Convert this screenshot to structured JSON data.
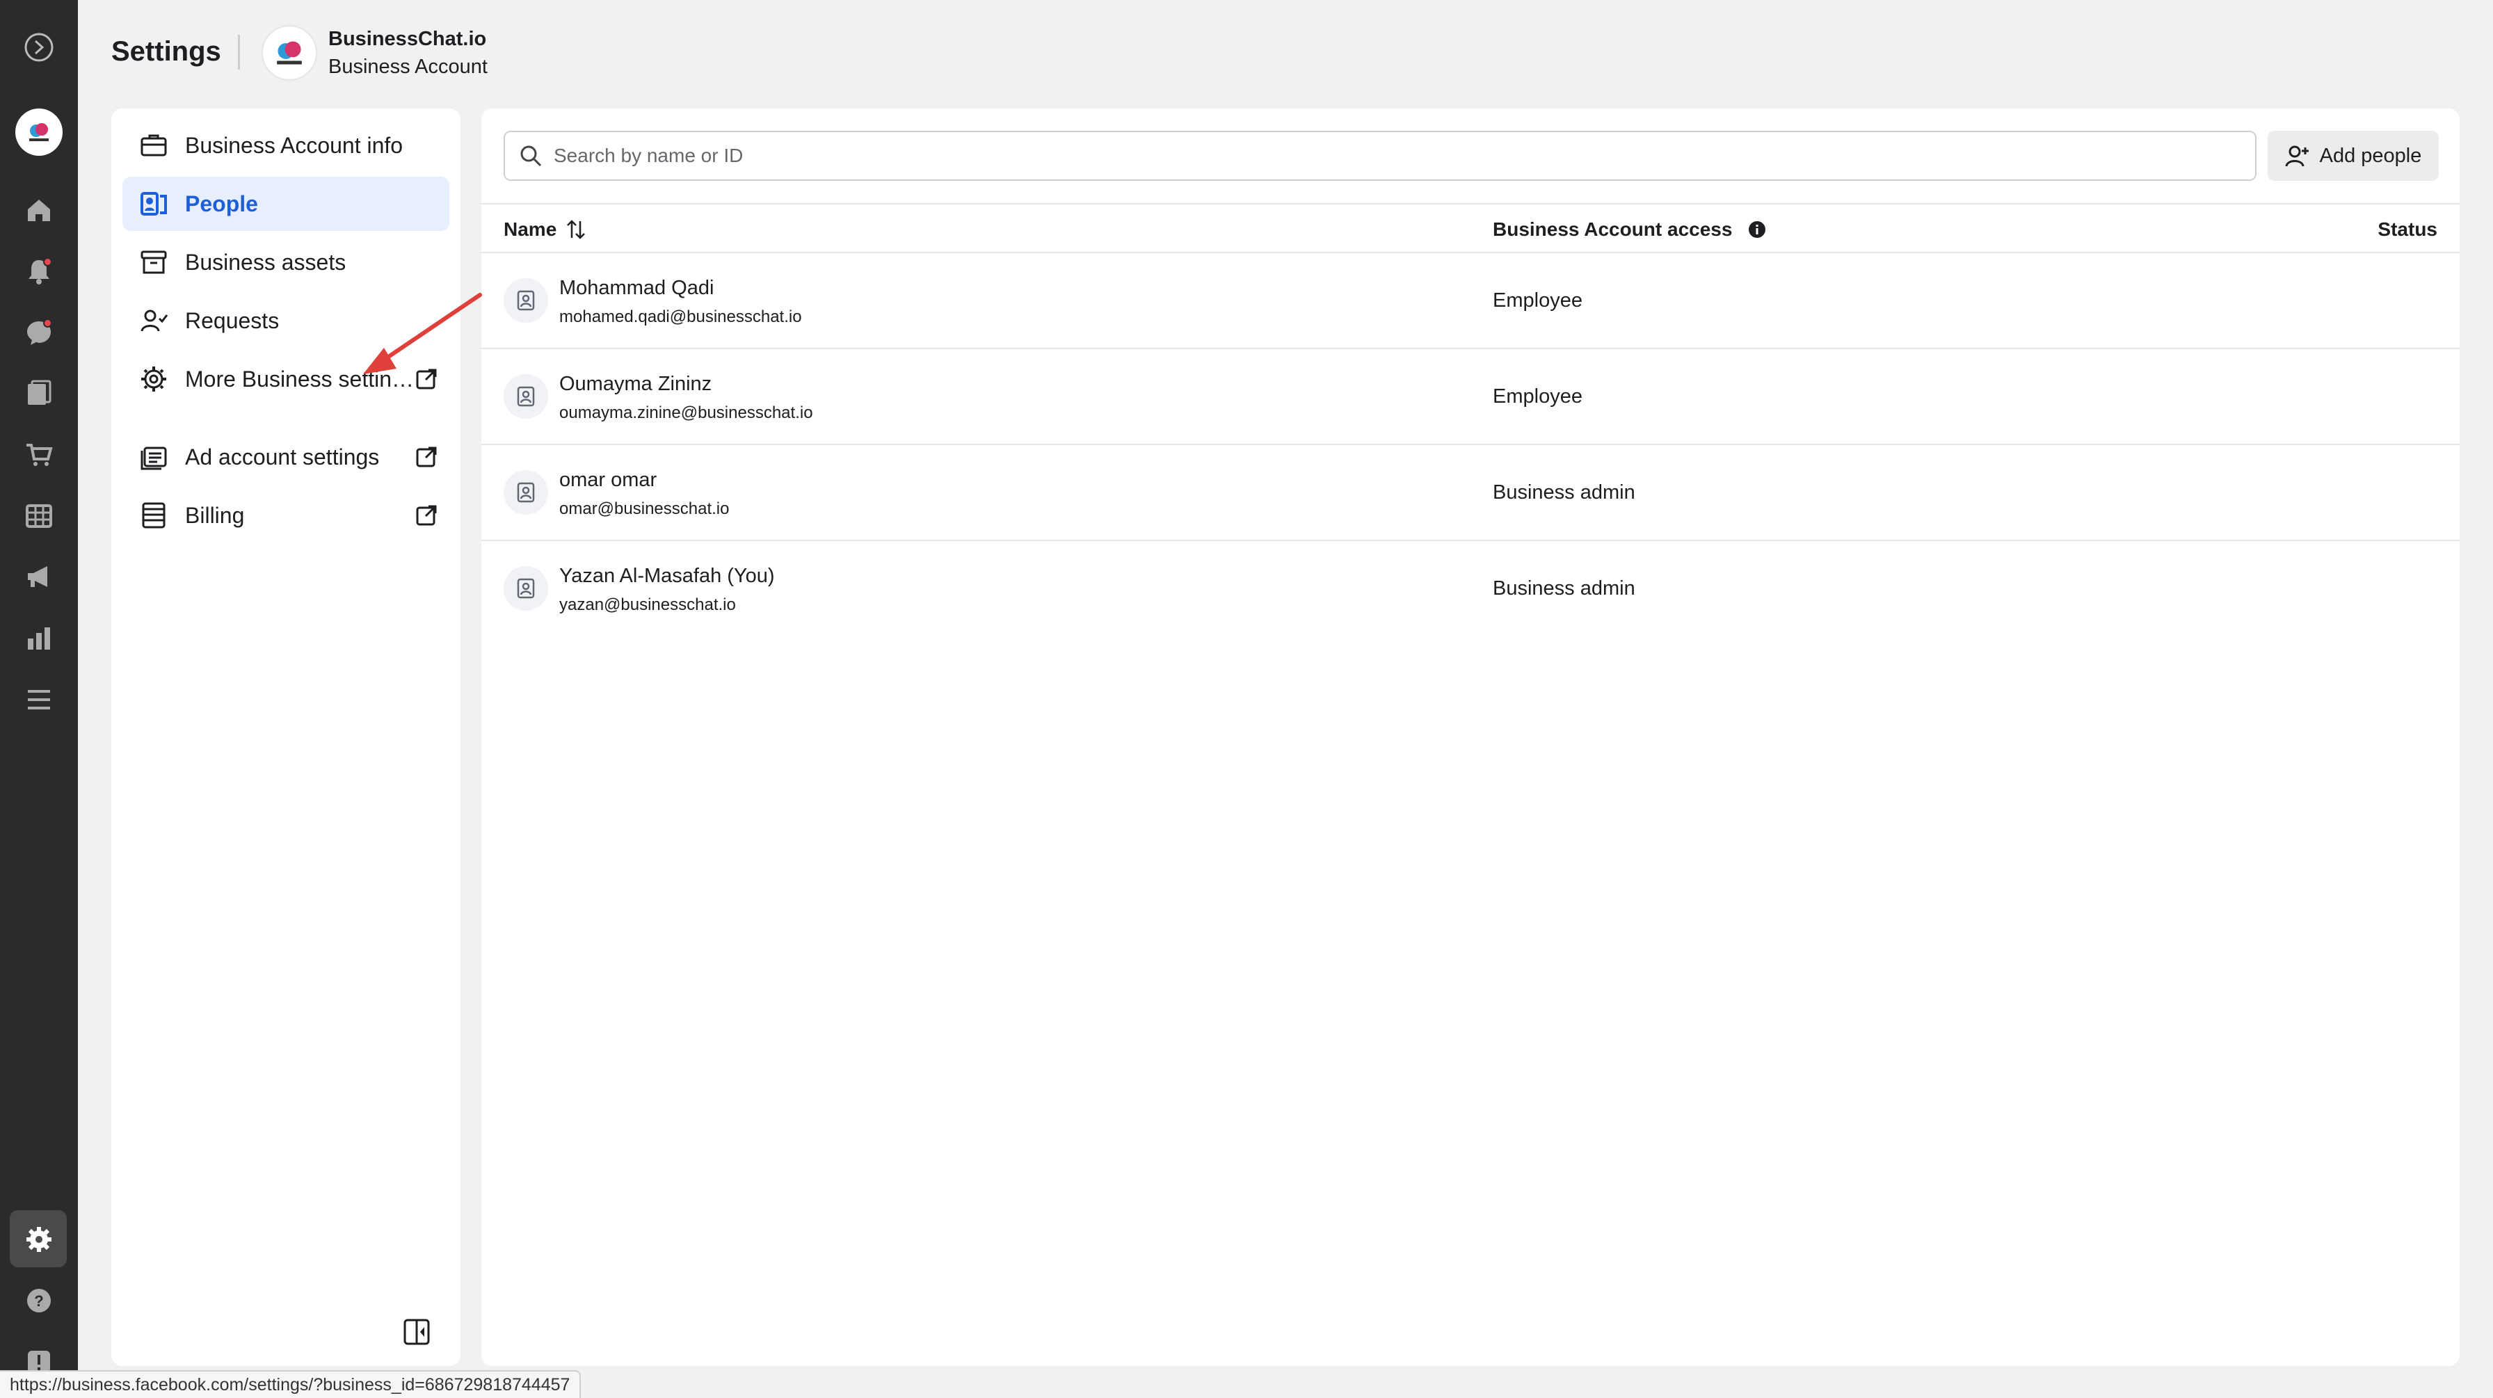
{
  "header": {
    "title": "Settings",
    "account_name": "BusinessChat.io",
    "account_type": "Business Account"
  },
  "nav": {
    "items": [
      {
        "label": "Business Account info",
        "icon": "briefcase-icon"
      },
      {
        "label": "People",
        "icon": "people-icon",
        "active": true
      },
      {
        "label": "Business assets",
        "icon": "archive-box-icon"
      },
      {
        "label": "Requests",
        "icon": "person-check-icon"
      },
      {
        "label": "More Business settin…",
        "icon": "gear-icon",
        "external": true
      },
      {
        "label": "Ad account settings",
        "icon": "ad-account-icon",
        "external": true
      },
      {
        "label": "Billing",
        "icon": "billing-stack-icon",
        "external": true
      }
    ]
  },
  "main": {
    "search_placeholder": "Search by name or ID",
    "add_people_label": "Add people",
    "columns": {
      "name": "Name",
      "access": "Business Account access",
      "status": "Status"
    },
    "people": [
      {
        "name": "Mohammad Qadi",
        "email": "mohamed.qadi@businesschat.io",
        "access": "Employee"
      },
      {
        "name": "Oumayma Zininz",
        "email": "oumayma.zinine@businesschat.io",
        "access": "Employee"
      },
      {
        "name": "omar omar",
        "email": "omar@businesschat.io",
        "access": "Business admin"
      },
      {
        "name": "Yazan Al-Masafah (You)",
        "email": "yazan@businesschat.io",
        "access": "Business admin"
      }
    ]
  },
  "status_url": "https://business.facebook.com/settings/?business_id=686729818744457",
  "colors": {
    "rail": "#2b2b2b",
    "active_nav_bg": "#e7efff",
    "active_nav_text": "#1d5fd8",
    "notification_dot": "#e5484d",
    "annotation_arrow": "#e0403a"
  }
}
